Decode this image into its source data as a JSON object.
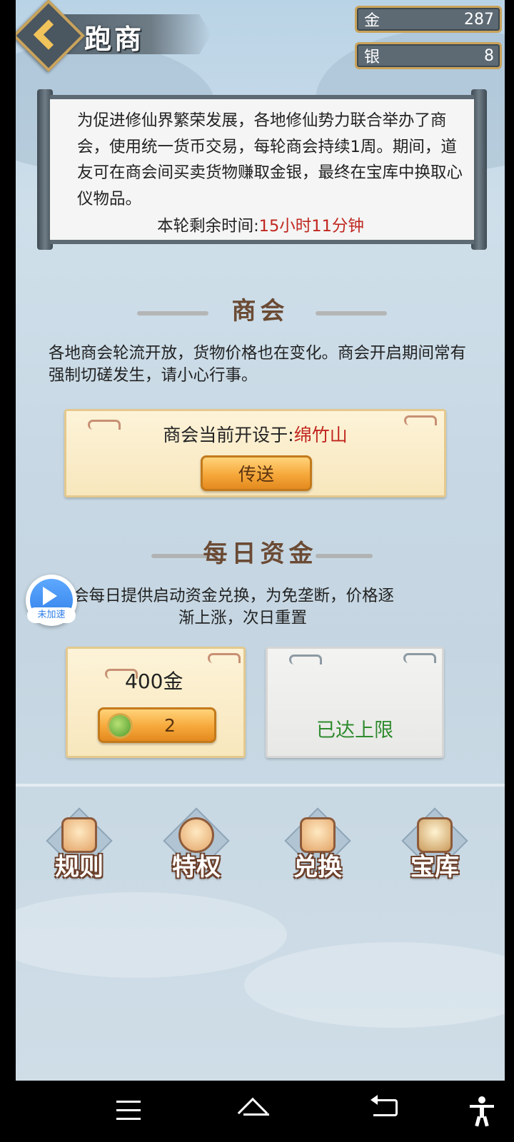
{
  "header": {
    "title": "跑商"
  },
  "currency": {
    "gold_label": "金",
    "gold_value": "287",
    "silver_label": "银",
    "silver_value": "8"
  },
  "intro": {
    "text": "为促进修仙界繁荣发展，各地修仙势力联合举办了商会，使用统一货币交易，每轮商会持续1周。期间，道友可在商会间买卖货物赚取金银，最终在宝库中换取心仪物品。",
    "timer_label": "本轮剩余时间:",
    "timer_value": "15小时11分钟"
  },
  "market": {
    "title": "商会",
    "description": "各地商会轮流开放，货物价格也在变化。商会开启期间常有强制切磋发生，请小心行事。",
    "location_label": "商会当前开设于:",
    "location_value": "绵竹山",
    "teleport_button": "传送"
  },
  "daily_funds": {
    "title": "每日资金",
    "description_line1": "会每日提供启动资金兑换，为免垄断，价格逐",
    "description_line2": "渐上涨，次日重置",
    "offer_amount": "400金",
    "offer_cost": "2",
    "limit_text": "已达上限"
  },
  "menu": {
    "items": [
      {
        "label": "规则",
        "icon": "rules-icon"
      },
      {
        "label": "特权",
        "icon": "privilege-icon"
      },
      {
        "label": "兑换",
        "icon": "exchange-icon"
      },
      {
        "label": "宝库",
        "icon": "treasury-icon"
      }
    ]
  },
  "overlay": {
    "speed_tag": "未加速"
  },
  "colors": {
    "timer_red": "#c0261f",
    "location_red": "#c0261f",
    "limit_green": "#2e8b2e",
    "gold_border": "#c9a35c"
  }
}
